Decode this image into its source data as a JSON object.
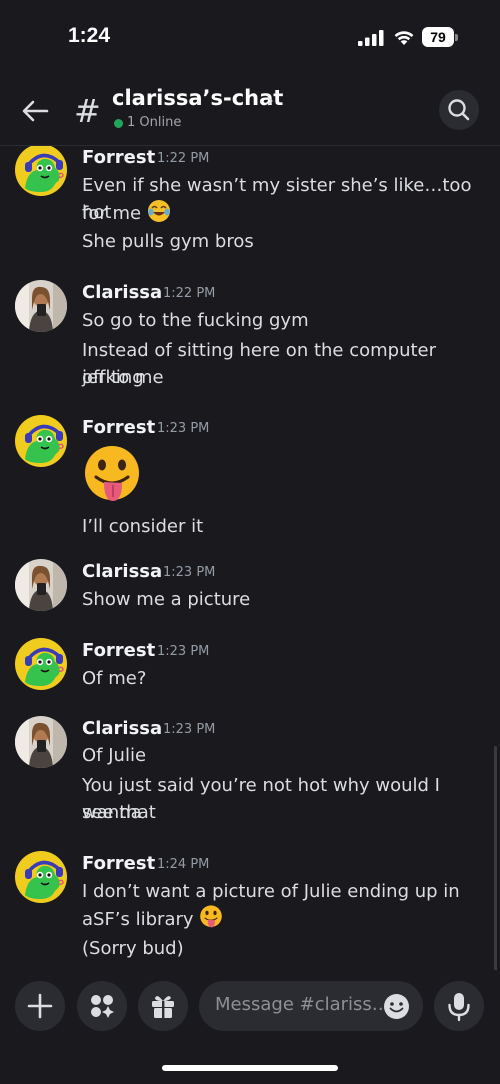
{
  "status_bar": {
    "time": "1:24",
    "battery": "79"
  },
  "header": {
    "channel_name": "clarissa’s-chat",
    "chevron": "›",
    "hash": "#",
    "online_status": "1 Online"
  },
  "messages": [
    {
      "author": "Forrest",
      "time": "1:22 PM",
      "avatar": "forrest-avatar",
      "lines": [
        "Even if she wasn’t my sister she’s like…too hot",
        "for me",
        "She pulls gym bros"
      ]
    },
    {
      "author": "Clarissa",
      "time": "1:22 PM",
      "avatar": "clarissa-avatar",
      "lines": [
        "So go to the fucking gym",
        "Instead of sitting here on the computer jerking",
        "off to me"
      ]
    },
    {
      "author": "Forrest",
      "time": "1:23 PM",
      "avatar": "forrest-avatar",
      "lines": [
        "I’ll consider it"
      ]
    },
    {
      "author": "Clarissa",
      "time": "1:23 PM",
      "avatar": "clarissa-avatar",
      "lines": [
        "Show me a picture"
      ]
    },
    {
      "author": "Forrest",
      "time": "1:23 PM",
      "avatar": "forrest-avatar",
      "lines": [
        "Of me?"
      ]
    },
    {
      "author": "Clarissa",
      "time": "1:23 PM",
      "avatar": "clarissa-avatar",
      "lines": [
        "Of Julie",
        "You just said you’re not hot why would I wanna",
        "see that"
      ]
    },
    {
      "author": "Forrest",
      "time": "1:24 PM",
      "avatar": "forrest-avatar",
      "lines": [
        "I don’t want a picture of Julie ending up in",
        "aSF’s library",
        "(Sorry bud)"
      ]
    }
  ],
  "input": {
    "placeholder": "Message #clariss…"
  },
  "colors": {
    "background": "#1a1a1e",
    "surface": "#2b2c31",
    "online": "#23a559",
    "forrest_avatar_bg": "#f0cc1f"
  },
  "icons": [
    "back-arrow-icon",
    "search-icon",
    "plus-icon",
    "apps-icon",
    "gift-icon",
    "emoji-icon",
    "microphone-icon"
  ]
}
